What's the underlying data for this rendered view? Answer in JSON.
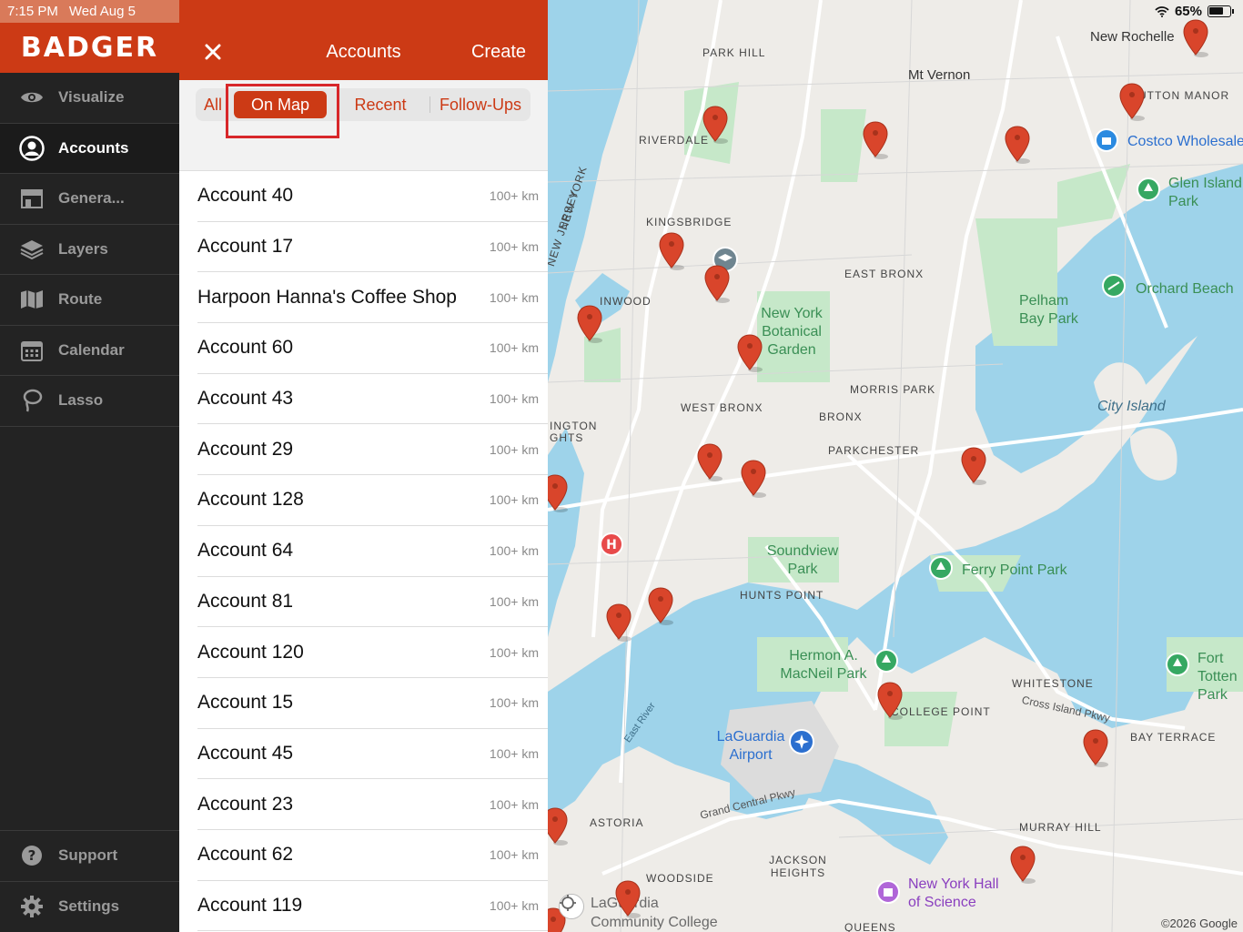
{
  "status": {
    "time": "7:15 PM",
    "date": "Wed Aug 5",
    "battery": "65%"
  },
  "brand": {
    "name": "BADGER"
  },
  "sidebar": {
    "items": [
      {
        "label": "Visualize",
        "icon": "eye-icon"
      },
      {
        "label": "Accounts",
        "icon": "user-circle-icon",
        "active": true
      },
      {
        "label": "Genera...",
        "icon": "storefront-icon"
      },
      {
        "label": "Layers",
        "icon": "layers-icon"
      },
      {
        "label": "Route",
        "icon": "map-icon"
      },
      {
        "label": "Calendar",
        "icon": "calendar-icon"
      },
      {
        "label": "Lasso",
        "icon": "lasso-icon"
      }
    ],
    "bottom": [
      {
        "label": "Support",
        "icon": "help-icon"
      },
      {
        "label": "Settings",
        "icon": "gear-icon"
      }
    ]
  },
  "panel": {
    "title": "Accounts",
    "create_label": "Create",
    "tabs": [
      {
        "label": "All"
      },
      {
        "label": "On Map",
        "selected": true
      },
      {
        "label": "Recent"
      },
      {
        "label": "Follow-Ups"
      }
    ],
    "accounts": [
      {
        "name": "Account 40",
        "distance": "100+ km"
      },
      {
        "name": "Account 17",
        "distance": "100+ km"
      },
      {
        "name": "Harpoon Hanna's Coffee Shop",
        "distance": "100+ km"
      },
      {
        "name": "Account 60",
        "distance": "100+ km"
      },
      {
        "name": "Account 43",
        "distance": "100+ km"
      },
      {
        "name": "Account 29",
        "distance": "100+ km"
      },
      {
        "name": "Account 128",
        "distance": "100+ km"
      },
      {
        "name": "Account 64",
        "distance": "100+ km"
      },
      {
        "name": "Account 81",
        "distance": "100+ km"
      },
      {
        "name": "Account 120",
        "distance": "100+ km"
      },
      {
        "name": "Account 15",
        "distance": "100+ km"
      },
      {
        "name": "Account 45",
        "distance": "100+ km"
      },
      {
        "name": "Account 23",
        "distance": "100+ km"
      },
      {
        "name": "Account 62",
        "distance": "100+ km"
      },
      {
        "name": "Account 119",
        "distance": "100+ km"
      }
    ]
  },
  "map": {
    "labels": {
      "new_rochelle": "New Rochelle",
      "mt_vernon": "Mt Vernon",
      "park_hill": "PARK HILL",
      "riverdale": "RIVERDALE",
      "kingsbridge": "KINGSBRIDGE",
      "inwood": "INWOOD",
      "sutton_manor": "SUTTON MANOR",
      "costco": "Costco Wholesale",
      "glen_island": "Glen Island Park",
      "orchard_beach": "Orchard Beach",
      "pelham_bay": "Pelham Bay Park",
      "east_bronx": "EAST BRONX",
      "botanical": "New York Botanical Garden",
      "morris_park": "MORRIS PARK",
      "bronx": "BRONX",
      "west_bronx": "WEST BRONX",
      "city_island": "City Island",
      "parkchester": "PARKCHESTER",
      "soundview": "Soundview Park",
      "ferry_point": "Ferry Point Park",
      "hunts_point": "HUNTS POINT",
      "macneil": "Hermon A. MacNeil Park",
      "whitestone": "WHITESTONE",
      "college_point": "COLLEGE POINT",
      "fort_totten": "Fort Totten Park",
      "laguardia": "LaGuardia Airport",
      "bay_terrace": "BAY TERRACE",
      "astoria": "ASTORIA",
      "murray_hill": "MURRAY HILL",
      "jackson_heights": "JACKSON HEIGHTS",
      "woodside": "WOODSIDE",
      "ny_hall_science": "New York Hall of Science",
      "laguardia_cc": "LaGuardia Community College",
      "queens": "QUEENS",
      "new_jersey": "NEW JERSEY",
      "new_york": "NEW YORK",
      "east_river": "East River",
      "cross_island": "Cross Island Pkwy",
      "grand_central": "Grand Central Pkwy",
      "washington_heights": "INGTON GHTS"
    },
    "copyright": "©2026 Google",
    "colors": {
      "water": "#9ed3ea",
      "park": "#c6e8c9",
      "land": "#eeece8",
      "pin": "#d9452b",
      "road": "#ffffff"
    }
  }
}
